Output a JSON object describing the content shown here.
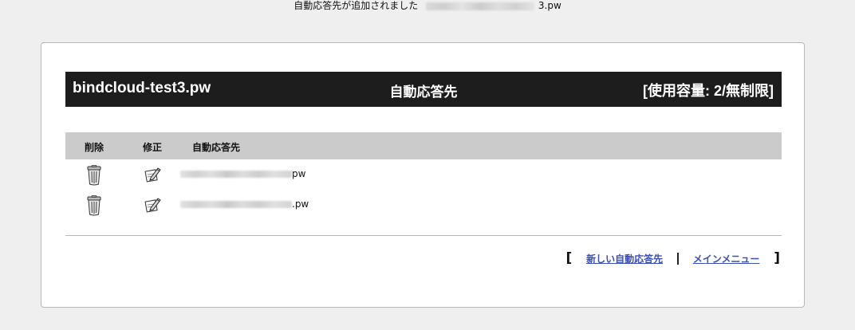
{
  "notice": {
    "message": "自動応答先が追加されました",
    "domain_suffix": "3.pw"
  },
  "header": {
    "domain": "bindcloud-test3.pw",
    "title": "自動応答先",
    "usage": "[使用容量: 2/無制限]"
  },
  "table": {
    "columns": [
      "削除",
      "修正",
      "自動応答先"
    ],
    "rows": [
      {
        "address_suffix": "pw"
      },
      {
        "address_suffix": ".pw"
      }
    ]
  },
  "footer": {
    "open_bracket": "[",
    "close_bracket": "]",
    "new_link": "新しい自動応答先",
    "menu_link": "メインメニュー"
  },
  "icons": {
    "delete": "trash-icon",
    "edit": "edit-pencil-icon"
  },
  "colors": {
    "header_bg": "#1d1d1d",
    "table_head_bg": "#cbcbcb",
    "link": "#3b4fb3"
  }
}
